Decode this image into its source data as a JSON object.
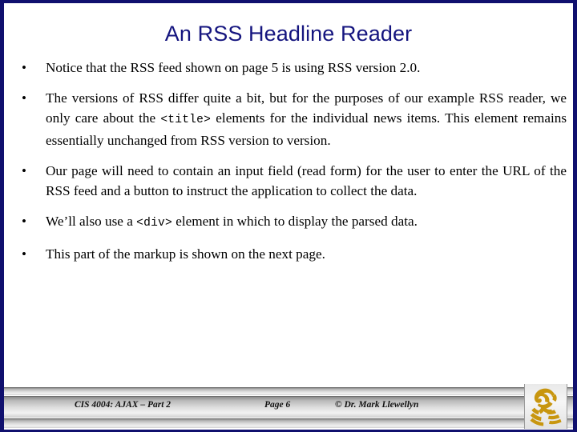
{
  "slide": {
    "title": "An RSS Headline Reader",
    "title_color": "#15157f",
    "border_color": "#10106e",
    "background_color": "#ffffff"
  },
  "bullets": [
    {
      "marker": "•",
      "parts": [
        {
          "type": "text",
          "value": "Notice that the RSS feed shown on page 5 is using RSS version 2.0."
        }
      ]
    },
    {
      "marker": "•",
      "parts": [
        {
          "type": "text",
          "value": "The versions of RSS differ quite a bit, but for the purposes of our example RSS reader, we only care about the "
        },
        {
          "type": "code",
          "value": "<title>"
        },
        {
          "type": "text",
          "value": " elements for the individual news items.  This element remains essentially unchanged from RSS version to version."
        }
      ]
    },
    {
      "marker": "•",
      "parts": [
        {
          "type": "text",
          "value": "Our page will need to contain an input field (read form) for the user to enter the URL of the RSS feed and a button to instruct the application to collect the data."
        }
      ]
    },
    {
      "marker": "•",
      "parts": [
        {
          "type": "text",
          "value": "We’ll also use a "
        },
        {
          "type": "code",
          "value": "<div>"
        },
        {
          "type": "text",
          "value": " element in which to display the parsed data."
        }
      ]
    },
    {
      "marker": "•",
      "parts": [
        {
          "type": "text",
          "value": "This part of the markup is shown on the next page."
        }
      ]
    }
  ],
  "footer": {
    "course": "CIS 4004: AJAX – Part 2",
    "page": "Page 6",
    "copyright": "© Dr. Mark Llewellyn",
    "logo_name": "ucf-pegasus-logo",
    "logo_color": "#c8960f"
  }
}
